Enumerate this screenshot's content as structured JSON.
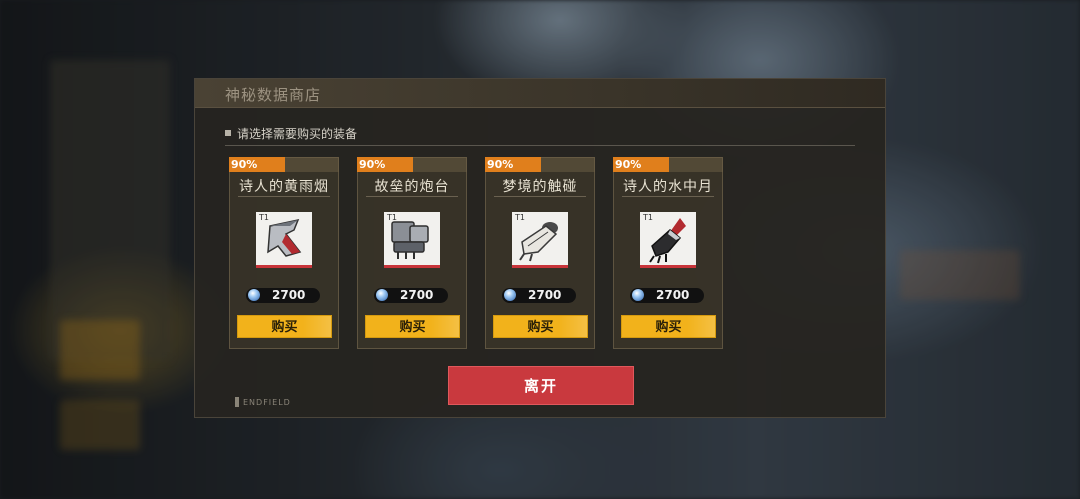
{
  "dialog": {
    "title": "神秘数据商店",
    "subtitle": "请选择需要购买的装备",
    "leave_label": "离开",
    "logo_text": "ENDFIELD"
  },
  "items": [
    {
      "discount": "90%",
      "name": "诗人的黄雨烟",
      "tier": "T1",
      "price": "2700",
      "buy_label": "购买",
      "icon": "blade-arm-icon"
    },
    {
      "discount": "90%",
      "name": "故垒的炮台",
      "tier": "T1",
      "price": "2700",
      "buy_label": "购买",
      "icon": "gauntlet-icon"
    },
    {
      "discount": "90%",
      "name": "梦境的触碰",
      "tier": "T1",
      "price": "2700",
      "buy_label": "购买",
      "icon": "bone-gauntlet-icon"
    },
    {
      "discount": "90%",
      "name": "诗人的水中月",
      "tier": "T1",
      "price": "2700",
      "buy_label": "购买",
      "icon": "claw-gauntlet-icon"
    }
  ],
  "colors": {
    "discount": "#e07f1c",
    "buy_button": "#f2b21b",
    "leave_button": "#c9393e",
    "rarity_stripe": "#c8343a"
  }
}
